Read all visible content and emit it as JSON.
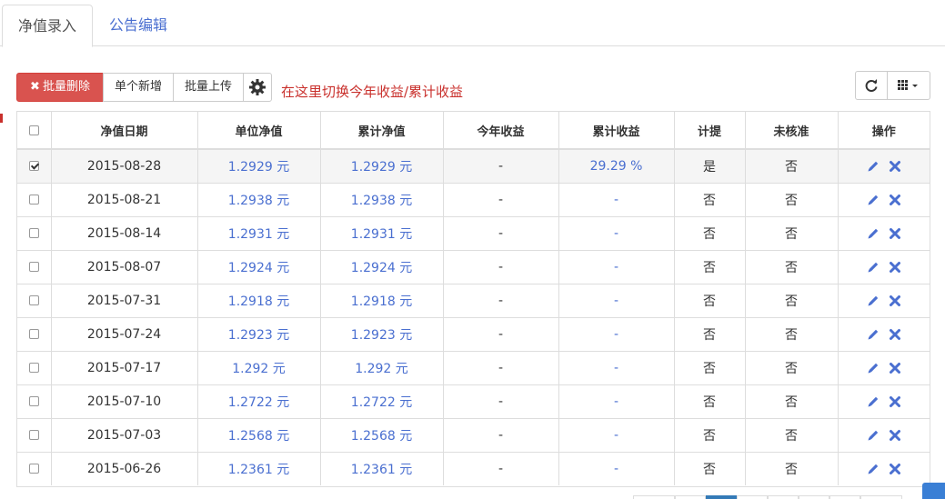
{
  "tabs": [
    {
      "label": "净值录入",
      "active": true
    },
    {
      "label": "公告编辑",
      "active": false
    }
  ],
  "toolbar": {
    "delete_icon": "✖",
    "delete_label": "批量删除",
    "add_label": "单个新增",
    "upload_label": "批量上传",
    "gear_icon": "gear-icon",
    "hint": "在这里切换今年收益/累计收益",
    "refresh_icon": "refresh-icon",
    "columns_icon": "grid-icon"
  },
  "table": {
    "columns": [
      "净值日期",
      "单位净值",
      "累计净值",
      "今年收益",
      "累计收益",
      "计提",
      "未核准",
      "操作"
    ],
    "rows": [
      {
        "checked": true,
        "date": "2015-08-28",
        "unit": "1.2929 元",
        "cum": "1.2929 元",
        "ytd": "-",
        "total": "29.29 %",
        "accrual": "是",
        "unverified": "否"
      },
      {
        "checked": false,
        "date": "2015-08-21",
        "unit": "1.2938 元",
        "cum": "1.2938 元",
        "ytd": "-",
        "total": "-",
        "accrual": "否",
        "unverified": "否"
      },
      {
        "checked": false,
        "date": "2015-08-14",
        "unit": "1.2931 元",
        "cum": "1.2931 元",
        "ytd": "-",
        "total": "-",
        "accrual": "否",
        "unverified": "否"
      },
      {
        "checked": false,
        "date": "2015-08-07",
        "unit": "1.2924 元",
        "cum": "1.2924 元",
        "ytd": "-",
        "total": "-",
        "accrual": "否",
        "unverified": "否"
      },
      {
        "checked": false,
        "date": "2015-07-31",
        "unit": "1.2918 元",
        "cum": "1.2918 元",
        "ytd": "-",
        "total": "-",
        "accrual": "否",
        "unverified": "否"
      },
      {
        "checked": false,
        "date": "2015-07-24",
        "unit": "1.2923 元",
        "cum": "1.2923 元",
        "ytd": "-",
        "total": "-",
        "accrual": "否",
        "unverified": "否"
      },
      {
        "checked": false,
        "date": "2015-07-17",
        "unit": "1.292 元",
        "cum": "1.292 元",
        "ytd": "-",
        "total": "-",
        "accrual": "否",
        "unverified": "否"
      },
      {
        "checked": false,
        "date": "2015-07-10",
        "unit": "1.2722 元",
        "cum": "1.2722 元",
        "ytd": "-",
        "total": "-",
        "accrual": "否",
        "unverified": "否"
      },
      {
        "checked": false,
        "date": "2015-07-03",
        "unit": "1.2568 元",
        "cum": "1.2568 元",
        "ytd": "-",
        "total": "-",
        "accrual": "否",
        "unverified": "否"
      },
      {
        "checked": false,
        "date": "2015-06-26",
        "unit": "1.2361 元",
        "cum": "1.2361 元",
        "ytd": "-",
        "total": "-",
        "accrual": "否",
        "unverified": "否"
      }
    ],
    "edit_icon": "pencil-icon",
    "delete_icon": "close-icon"
  },
  "colors": {
    "accent": "#4a6fd0",
    "danger": "#d9534f",
    "hint": "#c9302c"
  }
}
